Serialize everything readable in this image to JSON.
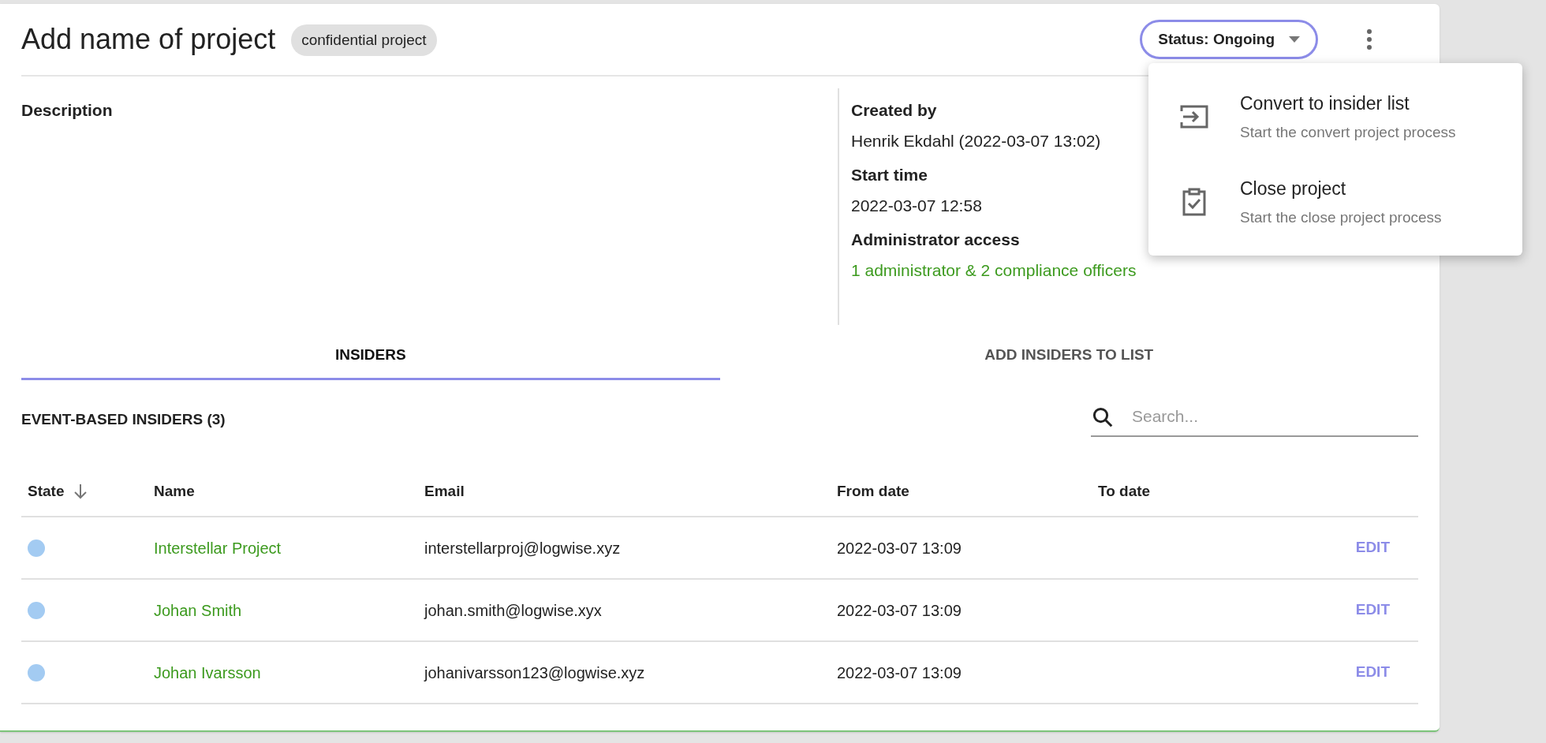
{
  "header": {
    "title": "Add name of project",
    "badge": "confidential project",
    "status_button": "Status: Ongoing"
  },
  "description": {
    "label": "Description"
  },
  "details": [
    {
      "label": "Created by",
      "value": "Henrik Ekdahl (2022-03-07 13:02)",
      "kind": "plain"
    },
    {
      "label": "Start time",
      "value": "2022-03-07 12:58",
      "kind": "plain"
    },
    {
      "label": "Administrator access",
      "value": "1 administrator & 2 compliance officers",
      "kind": "link"
    }
  ],
  "menu": {
    "items": [
      {
        "kind": "convert",
        "title": "Convert to insider list",
        "subtitle": "Start the convert project process"
      },
      {
        "kind": "close",
        "title": "Close project",
        "subtitle": "Start the close project process"
      }
    ]
  },
  "tabs": [
    {
      "label": "INSIDERS",
      "selected": true
    },
    {
      "label": "ADD INSIDERS TO LIST",
      "selected": false
    }
  ],
  "section_title": "EVENT-BASED INSIDERS (3)",
  "search": {
    "placeholder": "Search..."
  },
  "table": {
    "columns": [
      "State",
      "Name",
      "Email",
      "From date",
      "To date"
    ],
    "rows": [
      {
        "color": "#a3cbf2",
        "name": "Interstellar Project",
        "email": "interstellarproj@logwise.xyz",
        "from_date": "2022-03-07 13:09",
        "action": "EDIT"
      },
      {
        "color": "#a3cbf2",
        "name": "Johan Smith",
        "email": "johan.smith@logwise.xyx",
        "from_date": "2022-03-07 13:09",
        "action": "EDIT"
      },
      {
        "color": "#a3cbf2",
        "name": "Johan Ivarsson",
        "email": "johanivarsson123@logwise.xyz",
        "from_date": "2022-03-07 13:09",
        "action": "EDIT"
      }
    ]
  }
}
